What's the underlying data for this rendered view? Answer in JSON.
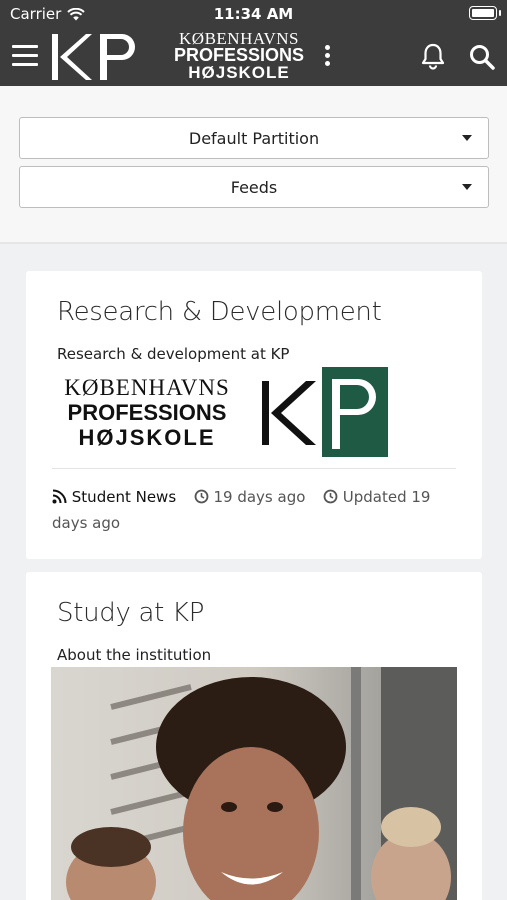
{
  "status_bar": {
    "carrier": "Carrier",
    "time": "11:34 AM"
  },
  "header": {
    "logo_letters": "KP",
    "brand_line1": "KØBENHAVNS",
    "brand_line2": "PROFESSIONS",
    "brand_line3": "HØJSKOLE"
  },
  "selectors": {
    "partition": "Default Partition",
    "feeds": "Feeds"
  },
  "cards": [
    {
      "title": "Research & Development",
      "description": "Research & development at KP",
      "image_wordmark": [
        "KØBENHAVNS",
        "PROFESSIONS",
        "HØJSKOLE"
      ],
      "feed": "Student News",
      "age": "19 days ago",
      "updated": "Updated 19 days ago"
    },
    {
      "title": "Study at KP",
      "description": "About the institution"
    }
  ],
  "colors": {
    "header_bg": "#3c3c3c",
    "kp_green": "#1f5a45"
  },
  "icons": [
    "menu-icon",
    "kebab-menu-icon",
    "bell-icon",
    "search-icon",
    "rss-icon",
    "clock-icon",
    "caret-down-icon"
  ]
}
